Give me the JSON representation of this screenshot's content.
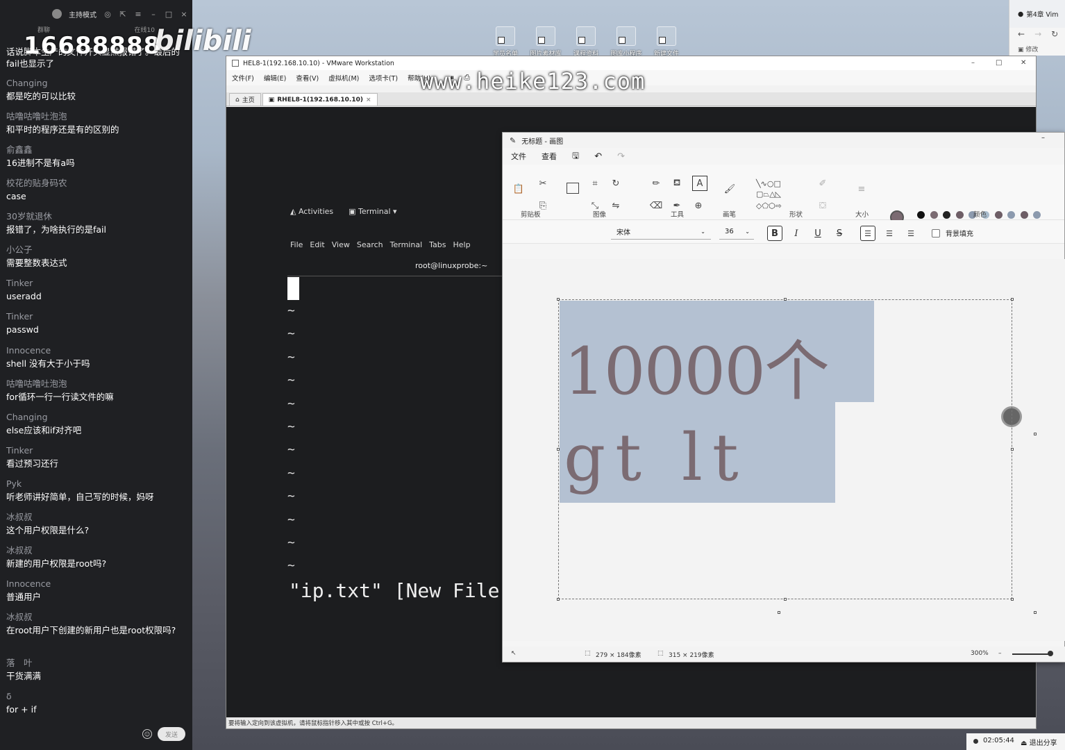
{
  "chat": {
    "mode_label": "主持模式",
    "sub_left": "群聊",
    "sub_right": "在线10",
    "watermark": "16688888",
    "bili_logo": "bilibili",
    "first_msg": "话说脚本生产的文件开头显然报错了。最后的fail也显示了",
    "messages": [
      {
        "user": "Changing",
        "text": "都是吃的可以比较"
      },
      {
        "user": "咕噜咕噜吐泡泡",
        "text": "和平时的程序还是有的区别的"
      },
      {
        "user": "俞鑫鑫",
        "text": "16进制不是有a吗"
      },
      {
        "user": "校花的贴身码农",
        "text": "case"
      },
      {
        "user": "30岁就退休",
        "text": "报错了，为啥执行的是fail"
      },
      {
        "user": "小公子",
        "text": "需要整数表达式"
      },
      {
        "user": "Tinker",
        "text": "useradd"
      },
      {
        "user": "Tinker",
        "text": "passwd"
      },
      {
        "user": "Innocence",
        "text": "shell 没有大于小于吗"
      },
      {
        "user": "咕噜咕噜吐泡泡",
        "text": "for循环一行一行读文件的嘛"
      },
      {
        "user": "Changing",
        "text": "else应该和if对齐吧"
      },
      {
        "user": "Tinker",
        "text": "看过预习还行"
      },
      {
        "user": "Pyk",
        "text": "听老师讲好简单，自己写的时候，妈呀"
      },
      {
        "user": "冰叔叔",
        "text": "这个用户权限是什么?"
      },
      {
        "user": "冰叔叔",
        "text": "新建的用户权限是root吗?"
      },
      {
        "user": "Innocence",
        "text": "普通用户"
      },
      {
        "user": "冰叔叔",
        "text": "在root用户下创建的新用户也是root权限吗?"
      },
      {
        "user": "落　叶",
        "text": "干货满满"
      },
      {
        "user": "δ",
        "text": "for + if"
      }
    ],
    "send_label": "发送"
  },
  "desktop": {
    "icons": [
      "学员名单",
      "图片素材库",
      "课程资料",
      "图库小程序",
      "新建文件"
    ]
  },
  "vmware": {
    "title": "HEL8-1(192.168.10.10) - VMware Workstation",
    "menu": [
      "文件(F)",
      "编辑(E)",
      "查看(V)",
      "虚拟机(M)",
      "选项卡(T)",
      "帮助(H)"
    ],
    "tabs": [
      "主页",
      "RHEL8-1(192.168.10.10)"
    ],
    "site_watermark": "www.heike123.com",
    "status": "要将输入定向到该虚拟机，请将鼠标指针移入其中或按 Ctrl+G。"
  },
  "guest": {
    "activities": "Activities",
    "terminal_menu": "Terminal ▾",
    "term_menu": [
      "File",
      "Edit",
      "View",
      "Search",
      "Terminal",
      "Tabs",
      "Help"
    ],
    "term_title": "root@linuxprobe:~",
    "tilde": "~",
    "vi_status": "\"ip.txt\" [New File"
  },
  "paint": {
    "title": "无标题 - 画图",
    "menu": [
      "文件",
      "查看"
    ],
    "groups": [
      "剪贴板",
      "图像",
      "工具",
      "画笔",
      "形状",
      "大小",
      "颜色"
    ],
    "font": "宋体",
    "size": "36",
    "bg_fill": "背景填充",
    "line1": "10000个",
    "line2": "gt lt",
    "status_sel": "279 × 184像素",
    "status_size": "315 × 219像素",
    "zoom": "300%",
    "colors": [
      "#111111",
      "#7b6b72",
      "#222222",
      "#6e5e66",
      "#8c9aae",
      "#a9bccd",
      "#6e5e66",
      "#8c9aae",
      "#6e5e66",
      "#8c9aae"
    ]
  },
  "browser": {
    "tab": "第4章 Vim",
    "edit": "修改"
  },
  "recording": {
    "time": "02:05:44",
    "exit": "退出分享"
  }
}
